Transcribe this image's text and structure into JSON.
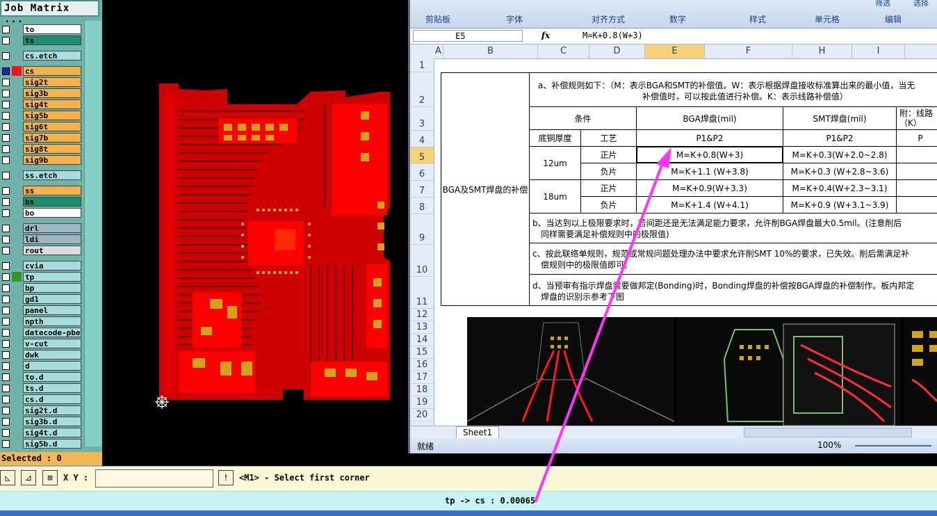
{
  "job_matrix": {
    "title": "Job Matrix ...",
    "layers": [
      {
        "name": "to",
        "color": "#ffffff"
      },
      {
        "name": "ts",
        "color": "#1c8e6f"
      },
      {
        "name": "cs.etch",
        "color": "#a9dcdc"
      },
      {
        "name": "cs",
        "color": "#f6b24a",
        "selected": true
      },
      {
        "name": "sig2t",
        "color": "#f6b24a"
      },
      {
        "name": "sig3b",
        "color": "#f6b24a"
      },
      {
        "name": "sig4t",
        "color": "#f6b24a"
      },
      {
        "name": "sig5b",
        "color": "#f6b24a"
      },
      {
        "name": "sig6t",
        "color": "#f6b24a"
      },
      {
        "name": "sig7b",
        "color": "#f6b24a"
      },
      {
        "name": "sig8t",
        "color": "#f6b24a"
      },
      {
        "name": "sig9b",
        "color": "#f6b24a"
      },
      {
        "name": "ss.etch",
        "color": "#a9dcdc"
      },
      {
        "name": "ss",
        "color": "#f6b24a"
      },
      {
        "name": "bs",
        "color": "#1c8e6f"
      },
      {
        "name": "bo",
        "color": "#ffffff"
      },
      {
        "name": "drl",
        "color": "#9eb7c3"
      },
      {
        "name": "ldi",
        "color": "#9eb7c3"
      },
      {
        "name": "rout",
        "color": "#dcdcdc"
      },
      {
        "name": "cvia",
        "color": "#a9dcdc"
      },
      {
        "name": "tp",
        "color": "#a9dcdc",
        "swatch": "#2e9a2e"
      },
      {
        "name": "bp",
        "color": "#a9dcdc"
      },
      {
        "name": "gd1",
        "color": "#a9dcdc"
      },
      {
        "name": "panel",
        "color": "#a9dcdc"
      },
      {
        "name": "npth",
        "color": "#a9dcdc"
      },
      {
        "name": "datecode-pbe",
        "color": "#a9dcdc"
      },
      {
        "name": "v-cut",
        "color": "#a9dcdc"
      },
      {
        "name": "dwk",
        "color": "#a9dcdc"
      },
      {
        "name": "d",
        "color": "#a9dcdc"
      },
      {
        "name": "to.d",
        "color": "#a9dcdc"
      },
      {
        "name": "ts.d",
        "color": "#a9dcdc"
      },
      {
        "name": "cs.d",
        "color": "#a9dcdc"
      },
      {
        "name": "sig2t.d",
        "color": "#a9dcdc"
      },
      {
        "name": "sig3b.d",
        "color": "#a9dcdc"
      },
      {
        "name": "sig4t.d",
        "color": "#a9dcdc"
      },
      {
        "name": "sig5b.d",
        "color": "#a9dcdc"
      }
    ],
    "selected_text": "Selected : 0"
  },
  "excel": {
    "ribbon_groups": [
      "剪贴板",
      "字体",
      "对齐方式",
      "数字",
      "样式",
      "单元格",
      "编辑"
    ],
    "ribbon_top": [
      "筛选",
      "选择"
    ],
    "name_box": "E5",
    "fx": "fx",
    "formula": "M=K+0.8(W+3)",
    "columns": [
      "A",
      "B",
      "C",
      "D",
      "E",
      "F",
      "H",
      "I"
    ],
    "rows": [
      "1",
      "2",
      "3",
      "4",
      "5",
      "6",
      "7",
      "8",
      "9",
      "10",
      "11",
      "12",
      "13",
      "14",
      "15",
      "16",
      "17",
      "18",
      "19",
      "20"
    ],
    "cells": {
      "a_rule_line1": "a、补偿规则如下：（M：表示BGA和SMT的补偿值。W：表示根据焊盘接收标准算出来的最小值，当无",
      "a_rule_line2": "补偿值时，可以按此值进行补偿。K：表示线路补偿值）",
      "side_label": "BGA及SMT焊盘的补偿",
      "cond": "条件",
      "bga": "BGA焊盘(mil)",
      "smt": "SMT焊盘(mil)",
      "attach": "附：线路",
      "attach2": "（K）",
      "thick": "底铜厚度",
      "craft": "工艺",
      "p1p2_e": "P1&P2",
      "p1p2_h": "P1&P2",
      "p_i": "P",
      "t12": "12um",
      "t18": "18um",
      "pos1": "正片",
      "neg1": "负片",
      "pos2": "正片",
      "neg2": "负片",
      "e5": "M=K+0.8(W+3)",
      "e6": "M=K+1.1 (W+3.8)",
      "e7": "M=K+0.9(W+3.3)",
      "e8": "M=K+1.4 (W+4.1)",
      "h5": "M=K+0.3(W+2.0~2.8)",
      "h6": "M=K+0.3 (W+2.8~3.6)",
      "h7": "M=K+0.4(W+2.3~3.1)",
      "h8": "M=K+0.9 (W+3.1~3.9)",
      "b_line1": "b、当达到以上极限要求时，若间距还是无法满足能力要求，允许削BGA焊盘最大0.5mil。(注意削后",
      "b_line2": "同样需要满足补偿规则中的极限值)",
      "c_line1": "c、按此联络单规则，规范或常规问题处理办法中要求允许削SMT 10%的要求，已失效。削后需满足补",
      "c_line2": "偿规则中的极限值即可。",
      "d_line1": "d、当预审有指示焊盘需要做邦定(Bonding)时，Bonding焊盘的补偿按BGA焊盘的补偿制作。板内邦定",
      "d_line2": "焊盘的识别示参考下图"
    },
    "sheet_tab": "Sheet1",
    "status_ready": "就绪",
    "zoom": "100%"
  },
  "command": {
    "xy_label": "X Y :",
    "xy_value": "",
    "prompt": "<M1> - Select first corner"
  },
  "message": "tp -> cs : 0.00065",
  "colors": {
    "pcb_red": "#ff0000",
    "pad_orange": "#d4a31a",
    "arrow": "#ff33ff"
  }
}
